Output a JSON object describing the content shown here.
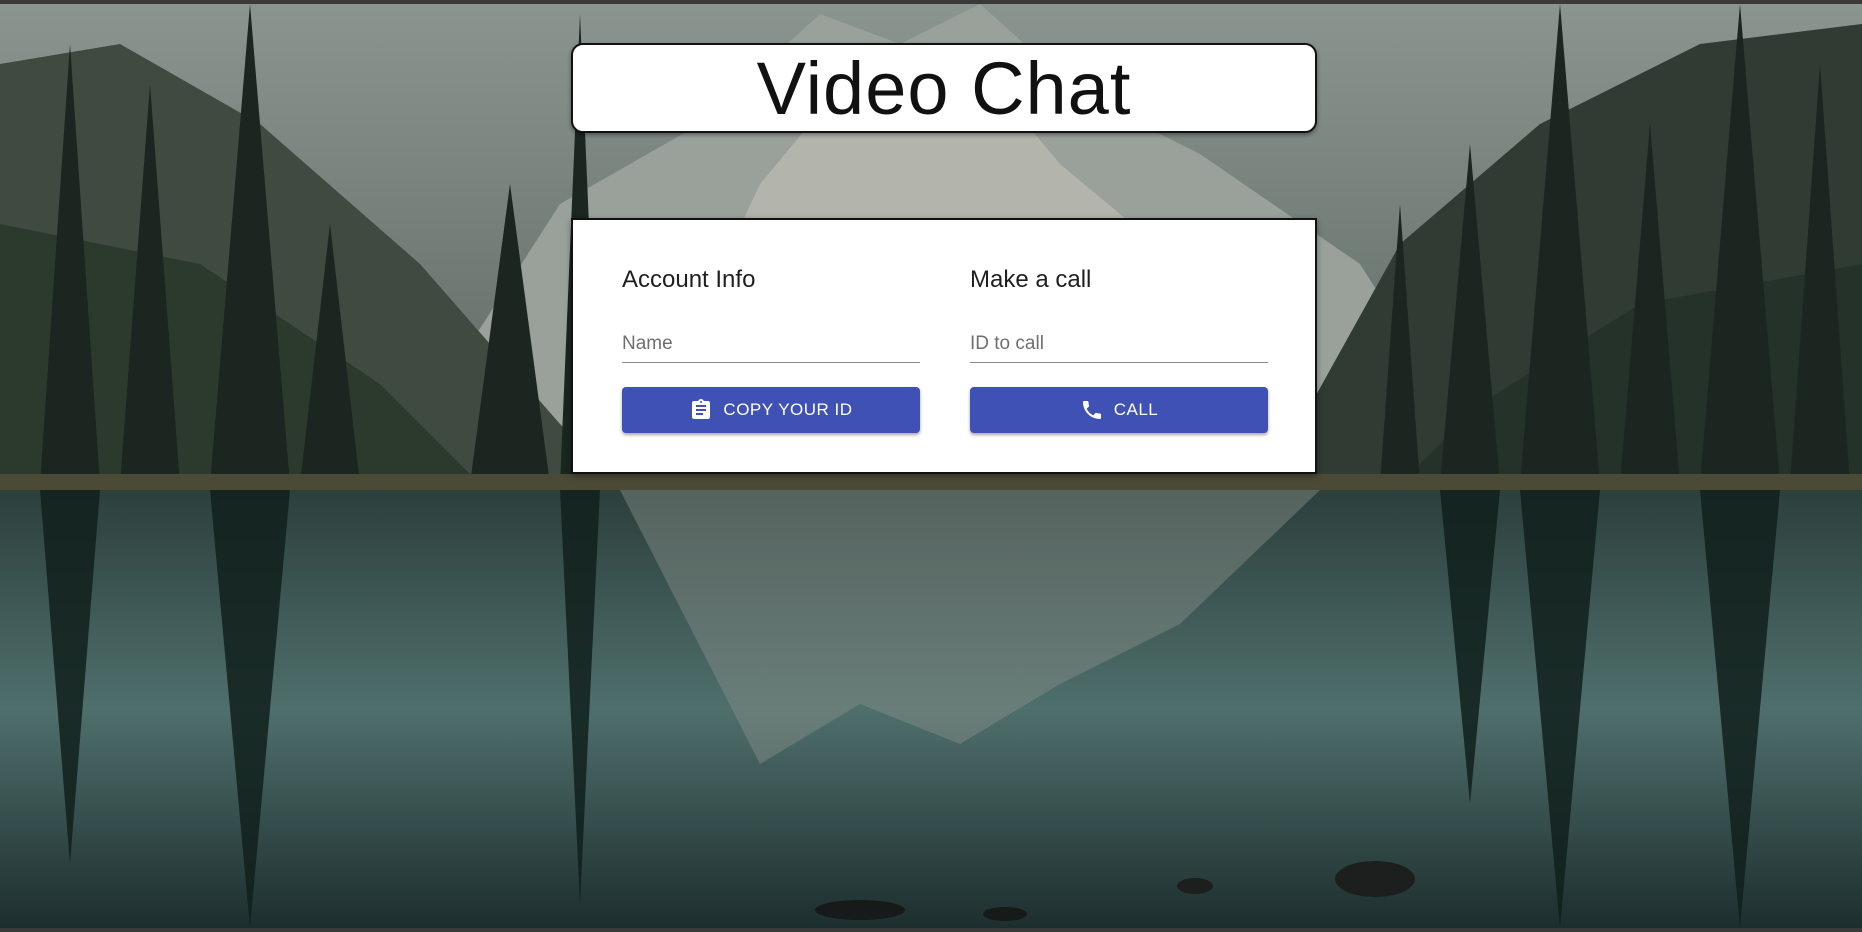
{
  "app": {
    "title": "Video Chat"
  },
  "account": {
    "heading": "Account Info",
    "name_placeholder": "Name",
    "name_value": "",
    "copy_button_label": "COPY YOUR ID",
    "copy_icon": "clipboard-icon"
  },
  "call": {
    "heading": "Make a call",
    "id_placeholder": "ID to call",
    "id_value": "",
    "call_button_label": "CALL",
    "call_icon": "phone-icon"
  },
  "colors": {
    "primary": "#3f51b5",
    "card_background": "#ffffff",
    "border": "#111111"
  }
}
